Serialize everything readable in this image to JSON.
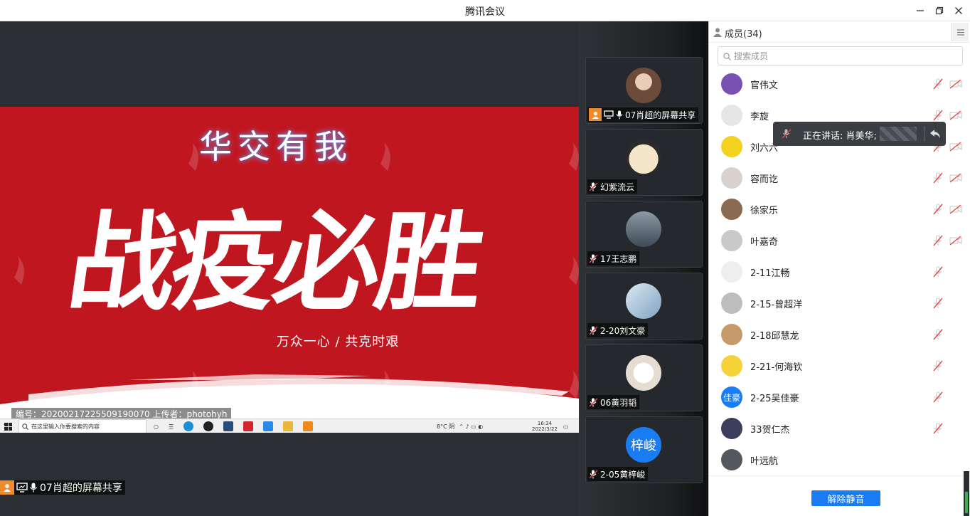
{
  "window": {
    "title": "腾讯会议"
  },
  "share": {
    "poster_title": "华交有我",
    "poster_big": "战疫必胜",
    "poster_sub": "万众一心 / 共克时艰",
    "caption": "编号：20200217225509190070 上传者：photohyh",
    "taskbar": {
      "search_placeholder": "在这里输入你要搜索的内容",
      "weather": "8°C 阴",
      "time": "16:34",
      "date": "2022/3/22"
    },
    "presenter_label": "07肖超的屏幕共享"
  },
  "tiles": [
    {
      "name": "07肖超的屏幕共享",
      "presenter": true,
      "avatar_color": "#6d4b3a"
    },
    {
      "name": "幻紫流云",
      "avatar_color": "#f4e7c9"
    },
    {
      "name": "17王志鹏",
      "avatar_color": "#5a6a78"
    },
    {
      "name": "2-20刘文豪",
      "avatar_color": "#b9d2e6"
    },
    {
      "name": "06黄羽韬",
      "avatar_color": "#f1ece4"
    },
    {
      "name": "2-05黄梓峻",
      "avatar_text": "梓峻",
      "avatar_color": "#1a7cf2"
    }
  ],
  "panel": {
    "members_label": "成员(34)",
    "search_placeholder": "搜索成员",
    "members": [
      {
        "name": "官伟文",
        "color": "#7a4fb2",
        "cam": true
      },
      {
        "name": "李旋",
        "color": "#e6e6e6",
        "cam": true
      },
      {
        "name": "刘六六",
        "color": "#f2d21f",
        "cam": true
      },
      {
        "name": "容而讫",
        "color": "#d9d2cc",
        "cam": true
      },
      {
        "name": "徐家乐",
        "color": "#8a6b52",
        "cam": true
      },
      {
        "name": "叶嘉奇",
        "color": "#c9c9c9",
        "cam": true
      },
      {
        "name": "2-11江畅",
        "color": "#eeeeee",
        "cam": false
      },
      {
        "name": "2-15-曾超洋",
        "color": "#bdbdbd",
        "cam": false
      },
      {
        "name": "2-18邱慧龙",
        "color": "#c79a6a",
        "cam": false
      },
      {
        "name": "2-21-何海钦",
        "color": "#f4d238",
        "cam": false
      },
      {
        "name": "2-25吴佳豪",
        "color": "#1a7cf2",
        "text": "佳豪",
        "cam": false
      },
      {
        "name": "33贺仁杰",
        "color": "#3c3f5c",
        "cam": false
      },
      {
        "name": "叶远航",
        "color": "#55585c",
        "cam": false,
        "nomic": true
      }
    ],
    "unmute_label": "解除静音"
  },
  "speaking": {
    "text": "正在讲话: 肖美华;"
  },
  "colors": {
    "accent": "#1a7cf2",
    "poster_red": "#c0161f",
    "presenter_orange": "#f08a2c",
    "mute_red": "#e24a4a"
  }
}
